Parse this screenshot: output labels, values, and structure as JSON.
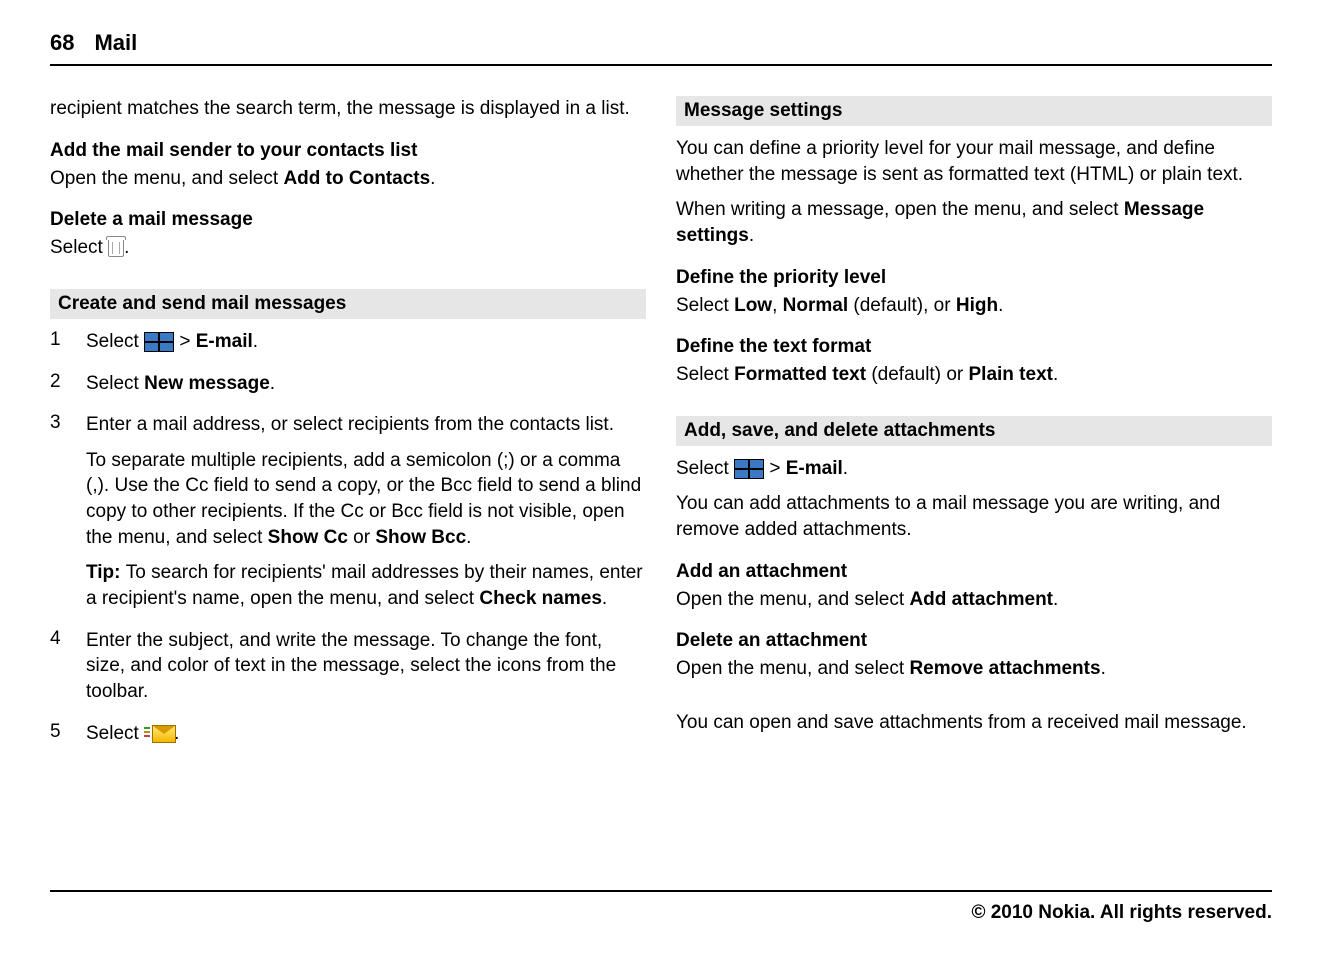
{
  "header": {
    "page_number": "68",
    "section": "Mail"
  },
  "left": {
    "intro": "recipient matches the search term, the message is displayed in a list.",
    "add_sender": {
      "heading": "Add the mail sender to your contacts list",
      "line_pre": "Open the menu, and select ",
      "action": "Add to Contacts",
      "line_post": "."
    },
    "delete_msg": {
      "heading": "Delete a mail message",
      "line_pre": "Select ",
      "line_post": "."
    },
    "create_section": {
      "heading": "Create and send mail messages",
      "steps": [
        {
          "num": "1",
          "pre": "Select ",
          "mid": " > ",
          "bold1": "E-mail",
          "post": "."
        },
        {
          "num": "2",
          "pre": "Select ",
          "bold1": "New message",
          "post": "."
        },
        {
          "num": "3",
          "p1": "Enter a mail address, or select recipients from the contacts list.",
          "p2_pre": "To separate multiple recipients, add a semicolon (;) or a comma (,). Use the Cc field to send a copy, or the Bcc field to send a blind copy to other recipients. If the Cc or Bcc field is not visible, open the menu, and select ",
          "p2_b1": "Show Cc",
          "p2_or": " or ",
          "p2_b2": "Show Bcc",
          "p2_post": ".",
          "p3_pre": "Tip: ",
          "p3_body": "To search for recipients' mail addresses by their names, enter a recipient's name, open the menu, and select ",
          "p3_b": "Check names",
          "p3_post": "."
        },
        {
          "num": "4",
          "p1": "Enter the subject, and write the message. To change the font, size, and color of text in the message, select the icons from the toolbar."
        },
        {
          "num": "5",
          "pre": "Select ",
          "post": "."
        }
      ]
    }
  },
  "right": {
    "settings": {
      "heading": "Message settings",
      "p1": "You can define a priority level for your mail message, and define whether the message is sent as formatted text (HTML) or plain text.",
      "p2_pre": "When writing a message, open the menu, and select ",
      "p2_b": "Message settings",
      "p2_post": ".",
      "priority": {
        "heading": "Define the priority level",
        "pre": "Select ",
        "b1": "Low",
        "c1": ", ",
        "b2": "Normal",
        "c2": " (default), or ",
        "b3": "High",
        "post": "."
      },
      "format": {
        "heading": "Define the text format",
        "pre": "Select ",
        "b1": "Formatted text",
        "c1": " (default) or ",
        "b2": "Plain text",
        "post": "."
      }
    },
    "attach": {
      "heading": "Add, save, and delete attachments",
      "line_pre": "Select ",
      "mid": " > ",
      "b1": "E-mail",
      "post": ".",
      "p2": "You can add attachments to a mail message you are writing, and remove added attachments.",
      "add": {
        "heading": "Add an attachment",
        "pre": "Open the menu, and select ",
        "b": "Add attachment",
        "post": "."
      },
      "del": {
        "heading": "Delete an attachment",
        "pre": "Open the menu, and select ",
        "b": "Remove attachments",
        "post": "."
      },
      "p3": "You can open and save attachments from a received mail message."
    }
  },
  "footer": "© 2010 Nokia. All rights reserved."
}
